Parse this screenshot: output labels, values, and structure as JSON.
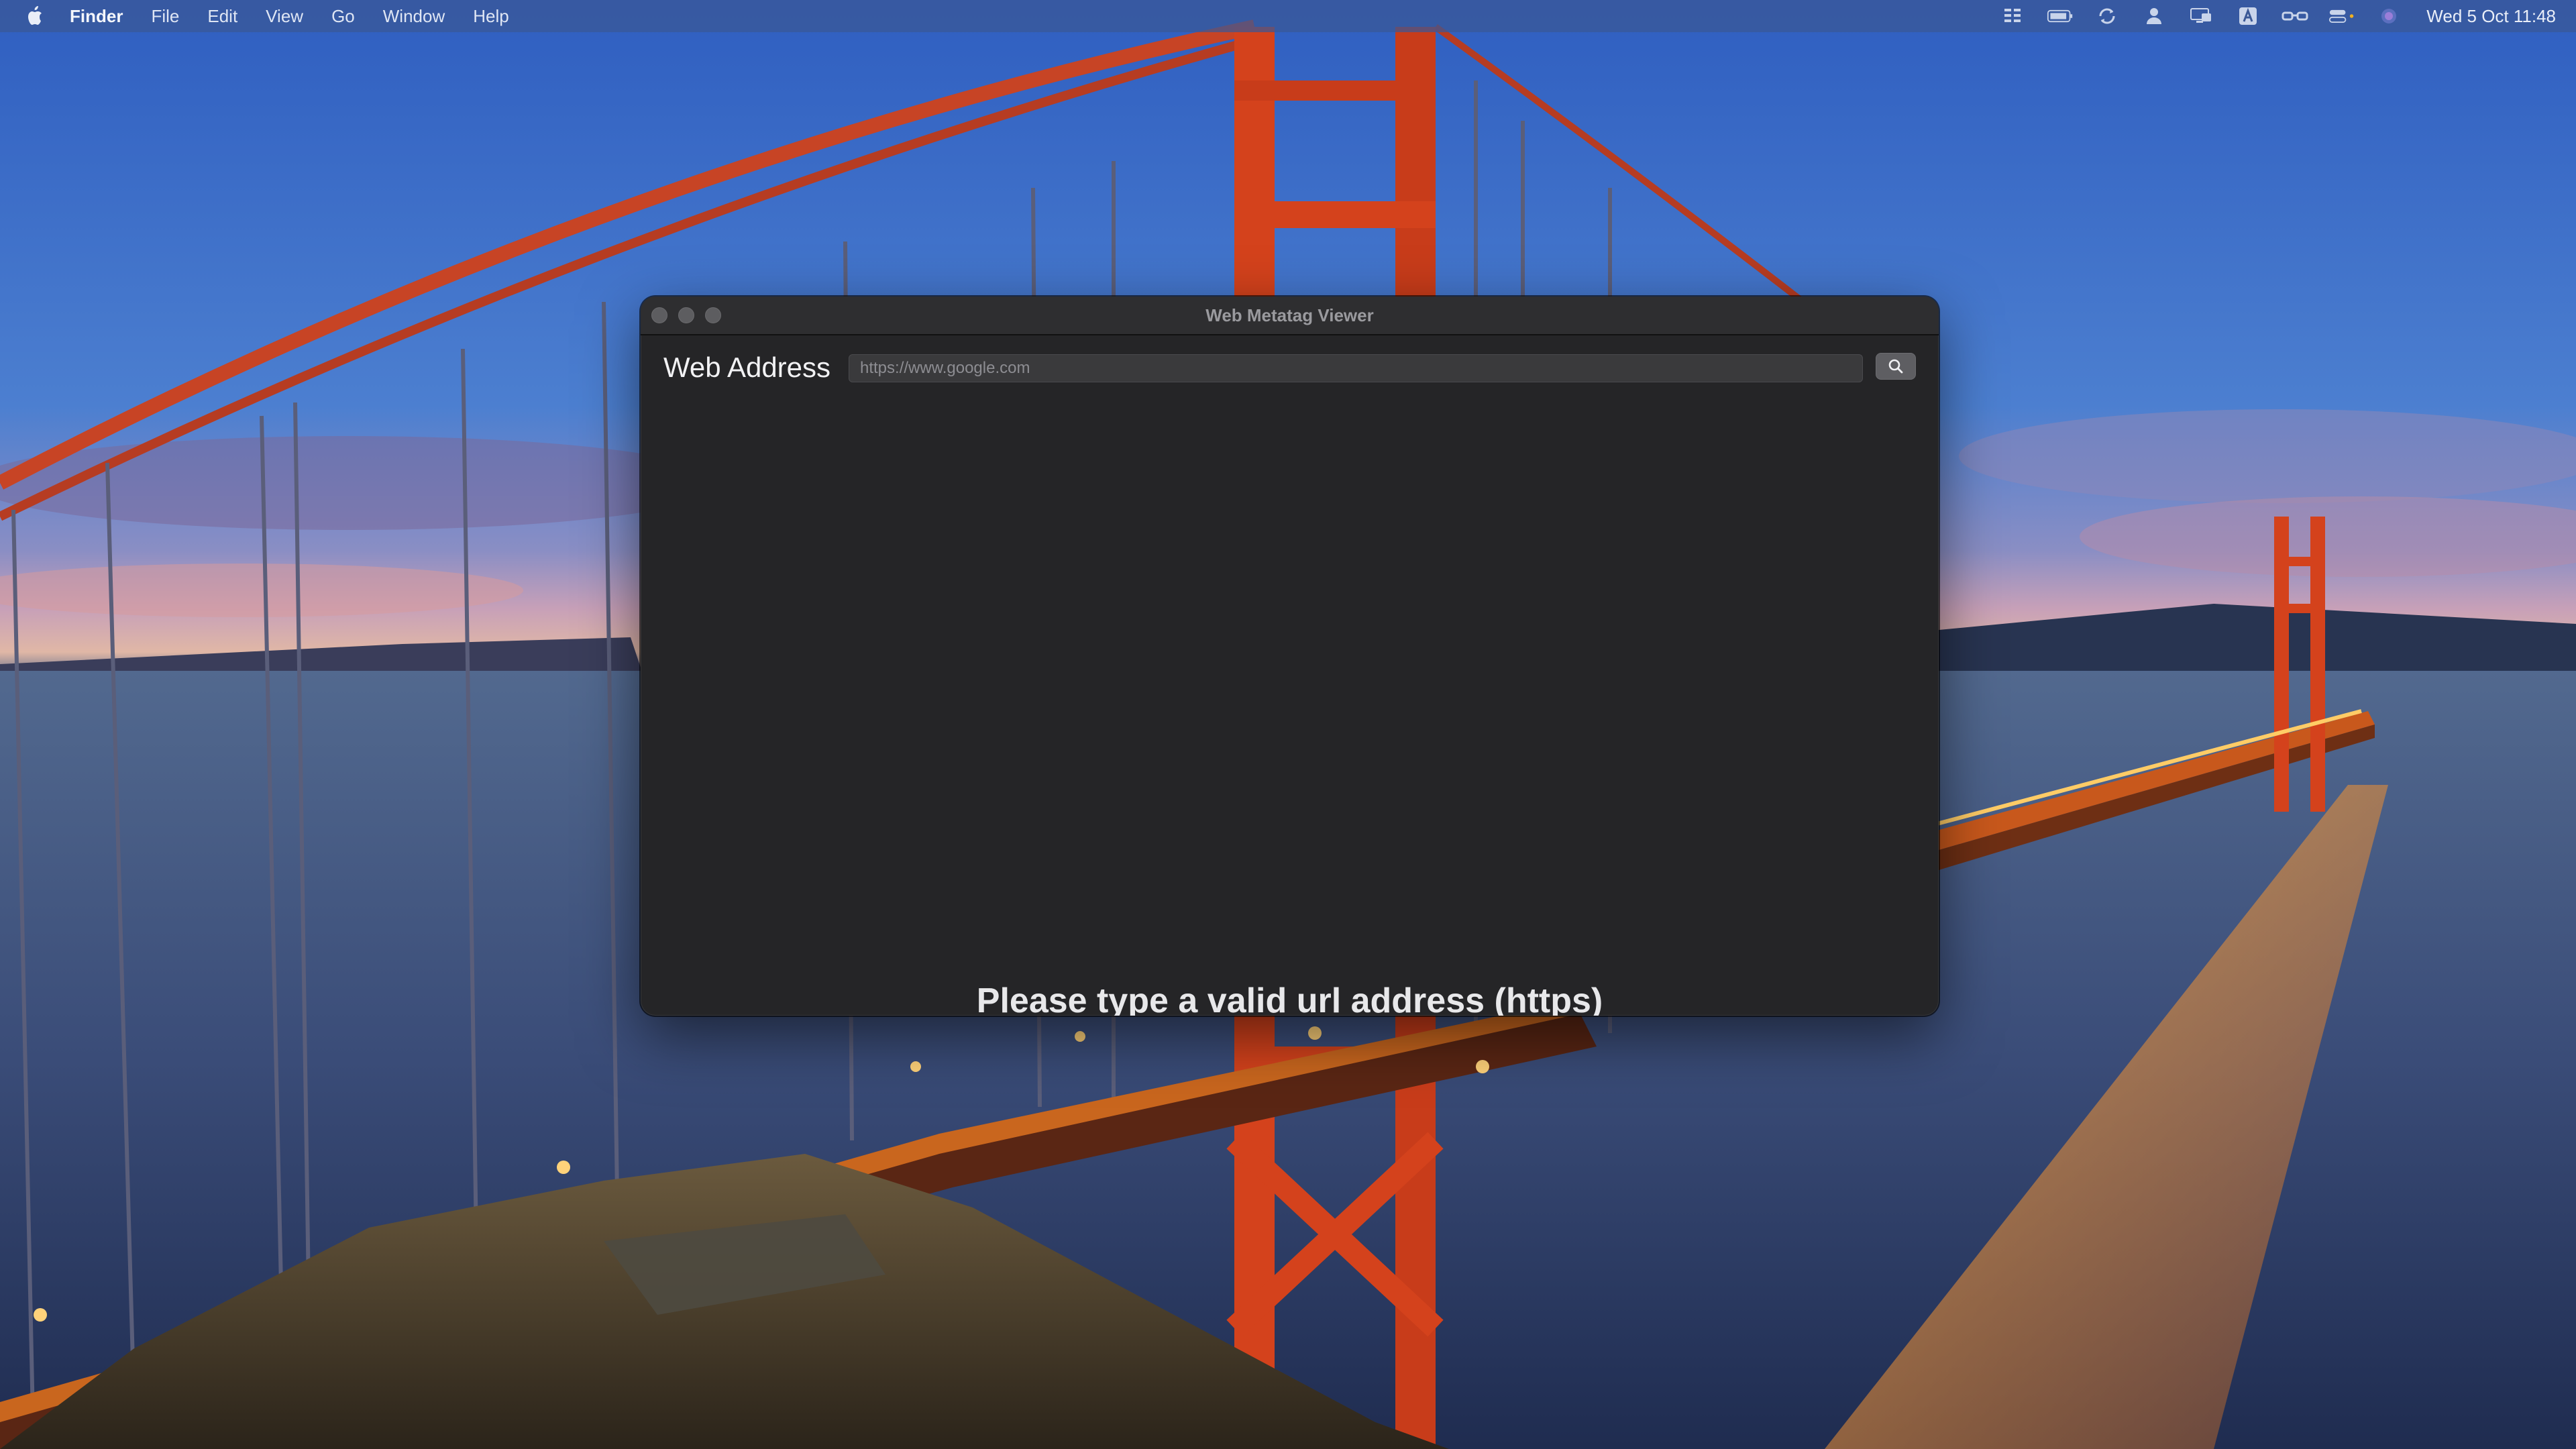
{
  "menubar": {
    "apple_icon": "apple-logo-icon",
    "items": [
      "Finder",
      "File",
      "Edit",
      "View",
      "Go",
      "Window",
      "Help"
    ],
    "status_icons": [
      "bars-icon",
      "battery-icon",
      "sync-icon",
      "user-icon",
      "display-icon",
      "keyboard-input-icon",
      "glasses-icon",
      "control-center-icon",
      "siri-icon"
    ],
    "clock": "Wed 5 Oct  11:48"
  },
  "window": {
    "title": "Web Metatag Viewer",
    "address_label": "Web Address",
    "url_placeholder": "https://www.google.com",
    "url_value": "",
    "search_icon": "search-icon",
    "message": "Please type a valid url address (https)"
  },
  "colors": {
    "window_bg": "#252527",
    "titlebar_bg": "#2e2e30",
    "menubar_bg": "#3a5896",
    "bridge_orange": "#d4421c"
  }
}
